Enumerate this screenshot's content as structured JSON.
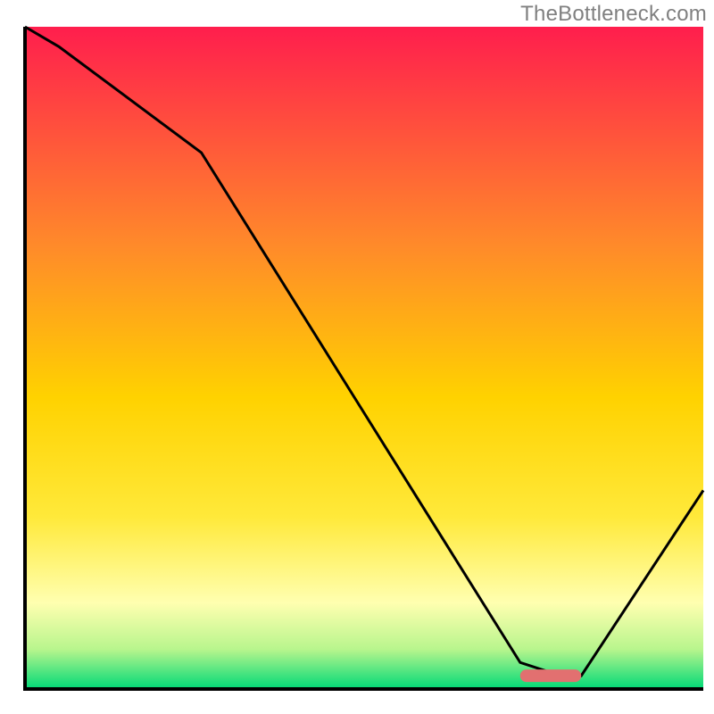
{
  "watermark_text": "TheBottleneck.com",
  "colors": {
    "watermark": "#808080",
    "curve": "#000000",
    "marker": "#e27070",
    "grad_red": "#ff1e4d",
    "grad_orange": "#ff8a2a",
    "grad_yellow_top": "#ffd200",
    "grad_yellow_mid": "#ffe93a",
    "grad_yellow_pale": "#ffffb0",
    "grad_green_upper": "#b8f58d",
    "grad_green_lower": "#00d977"
  },
  "chart_data": {
    "type": "line",
    "title": "",
    "xlabel": "",
    "ylabel": "",
    "xlim": [
      0,
      100
    ],
    "ylim": [
      0,
      100
    ],
    "x": [
      0,
      5,
      26,
      73,
      79,
      82,
      100
    ],
    "values": [
      100,
      97,
      81,
      4,
      2,
      2,
      30
    ],
    "optimal_range_x": [
      73,
      82
    ],
    "optimal_value": 2,
    "curve_color": "#000000",
    "marker_color": "#e27070"
  }
}
